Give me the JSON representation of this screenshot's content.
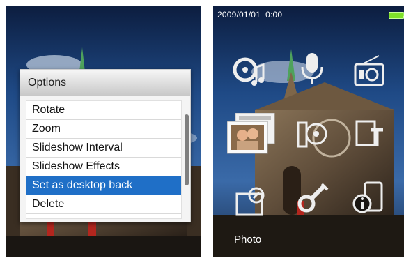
{
  "options_menu": {
    "title": "Options",
    "items": [
      {
        "label": "Rotate",
        "selected": false
      },
      {
        "label": "Zoom",
        "selected": false
      },
      {
        "label": "Slideshow Interval",
        "selected": false
      },
      {
        "label": "Slideshow Effects",
        "selected": false
      },
      {
        "label": "Set as desktop back",
        "selected": true
      },
      {
        "label": "Delete",
        "selected": false
      }
    ]
  },
  "status_bar": {
    "date": "2009/01/01",
    "time": "0:00",
    "battery_color": "#7fe02a"
  },
  "main_menu": {
    "icons": [
      "music-icon",
      "voice-recorder-icon",
      "radio-icon",
      "photo-icon",
      "video-icon",
      "ebook-icon",
      "folder-icon",
      "settings-icon",
      "info-icon"
    ],
    "selected": "photo-icon",
    "selected_label": "Photo"
  },
  "colors": {
    "selection": "#1f6fc7",
    "sky": "#17305c"
  }
}
